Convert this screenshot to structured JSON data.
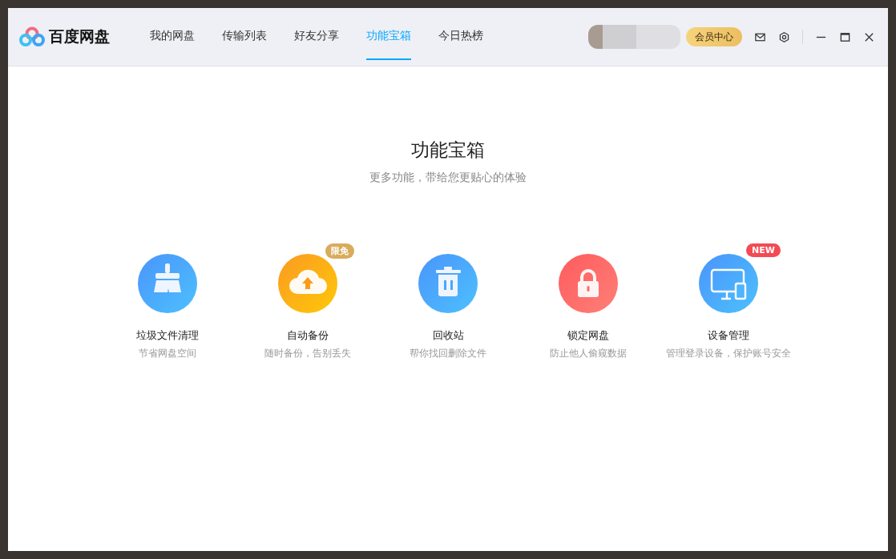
{
  "app": {
    "name": "百度网盘"
  },
  "tabs": [
    {
      "label": "我的网盘",
      "selected": false
    },
    {
      "label": "传输列表",
      "selected": false
    },
    {
      "label": "好友分享",
      "selected": false
    },
    {
      "label": "功能宝箱",
      "selected": true
    },
    {
      "label": "今日热榜",
      "selected": false
    }
  ],
  "header": {
    "vip_button": "会员中心"
  },
  "page": {
    "title": "功能宝箱",
    "subtitle": "更多功能，带给您更贴心的体验"
  },
  "tools": [
    {
      "kind": "cleanup",
      "name": "垃圾文件清理",
      "description": "节省网盘空间"
    },
    {
      "kind": "backup",
      "name": "自动备份",
      "description": "随时备份，告别丢失",
      "badge": {
        "text": "限免",
        "color": "#d9ab5c"
      }
    },
    {
      "kind": "recycle",
      "name": "回收站",
      "description": "帮你找回删除文件"
    },
    {
      "kind": "lock",
      "name": "锁定网盘",
      "description": "防止他人偷窥数据"
    },
    {
      "kind": "devices",
      "name": "设备管理",
      "description": "管理登录设备，保护账号安全",
      "badge": {
        "text": "NEW",
        "color": "#f24b53"
      }
    }
  ]
}
